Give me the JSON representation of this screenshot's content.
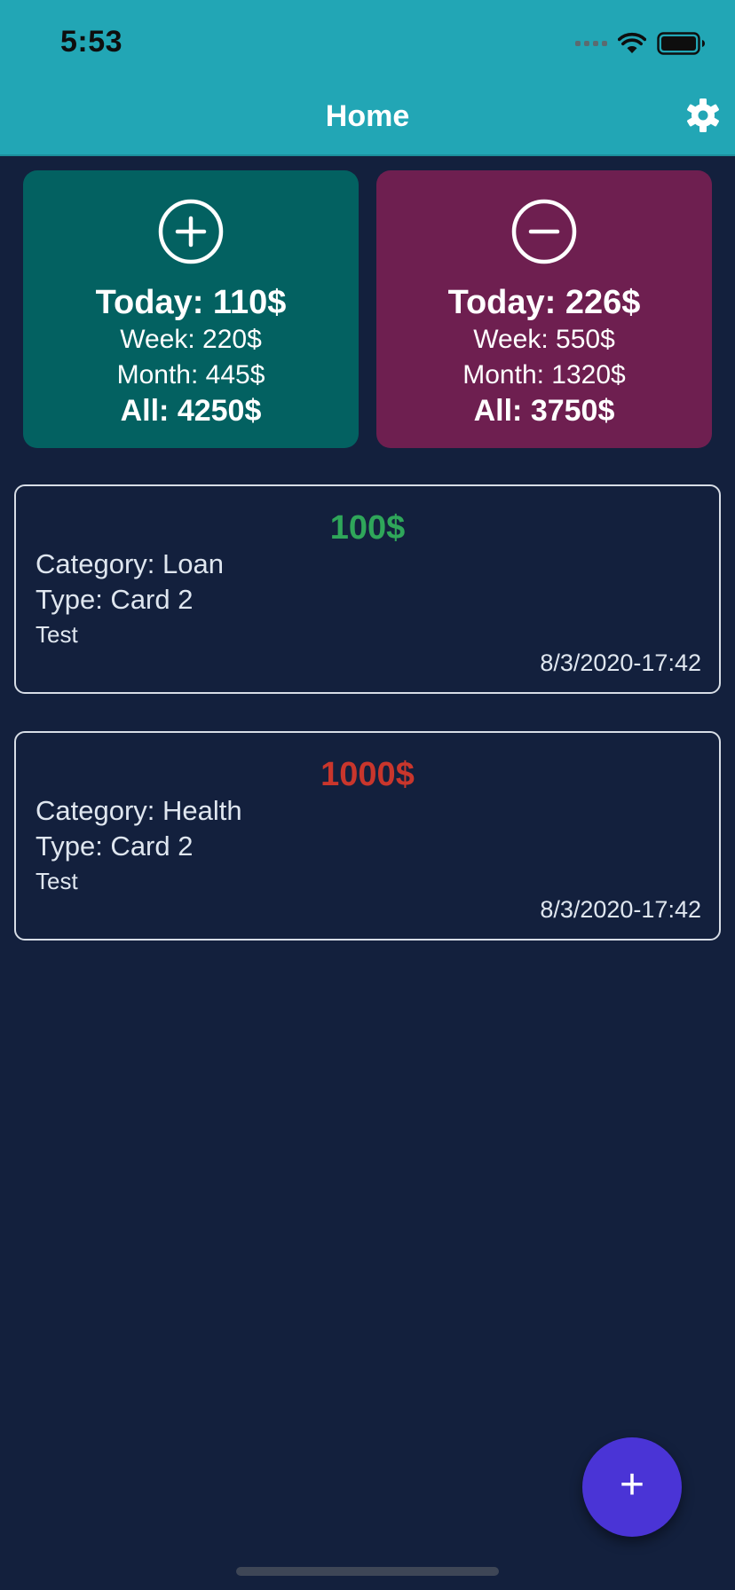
{
  "status_bar": {
    "time": "5:53",
    "icons": [
      "signal-icon",
      "wifi-icon",
      "battery-icon"
    ]
  },
  "header": {
    "title": "Home",
    "settings_icon": "gear-icon",
    "background": "#22a6b5"
  },
  "summary": {
    "income": {
      "icon": "plus-circle-icon",
      "color": "#036161",
      "today": "Today: 110$",
      "week": "Week: 220$",
      "month": "Month: 445$",
      "all": "All: 4250$"
    },
    "expense": {
      "icon": "minus-circle-icon",
      "color": "#6e1f50",
      "today": "Today: 226$",
      "week": "Week: 550$",
      "month": "Month: 1320$",
      "all": "All: 3750$"
    }
  },
  "transactions": [
    {
      "amount": "100$",
      "kind": "income",
      "amount_color": "#2fa65a",
      "category": "Category: Loan",
      "type": "Type: Card 2",
      "note": "Test",
      "datetime": "8/3/2020-17:42"
    },
    {
      "amount": "1000$",
      "kind": "expense",
      "amount_color": "#c9362c",
      "category": "Category: Health",
      "type": "Type: Card 2",
      "note": "Test",
      "datetime": "8/3/2020-17:42"
    }
  ],
  "fab": {
    "label": "+",
    "icon": "plus-icon",
    "color": "#4a34d6"
  },
  "colors": {
    "background": "#13203d"
  }
}
